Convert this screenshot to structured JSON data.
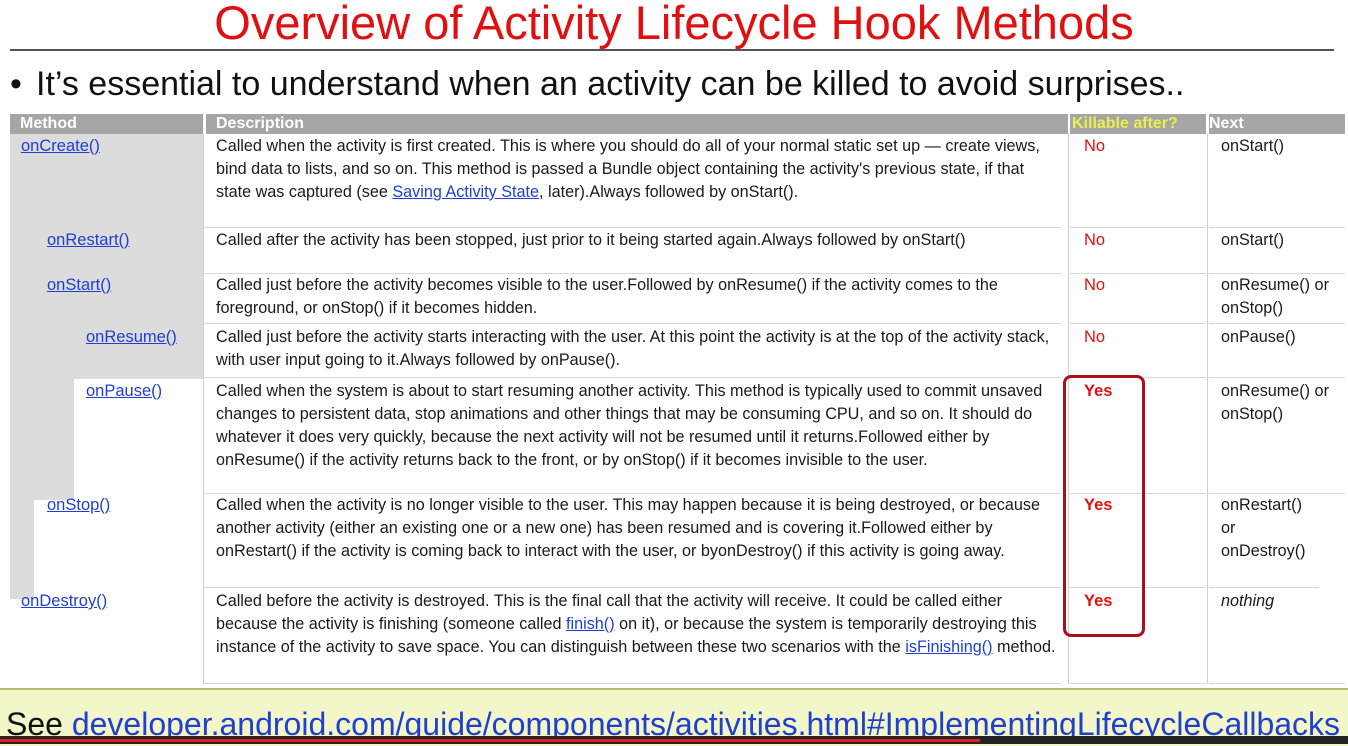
{
  "title": "Overview of Activity Lifecycle Hook Methods",
  "bullet": "It’s essential to understand when an activity can be killed to avoid surprises..",
  "headers": {
    "method": "Method",
    "description": "Description",
    "killable": "Killable after?",
    "next": "Next"
  },
  "rows": [
    {
      "method": "onCreate()",
      "desc_a": "Called when the activity is first created. This is where you should do all of your normal static set up — create views, bind data to lists, and so on. This method is passed a Bundle object containing the activity's previous state, if that state was captured (see ",
      "desc_link": "Saving Activity State",
      "desc_b": ", later).Always followed by onStart().",
      "killable": "No",
      "next": "onStart()"
    },
    {
      "method": "onRestart()",
      "desc": "Called after the activity has been stopped, just prior to it being started again.Always followed by onStart()",
      "killable": "No",
      "next": "onStart()"
    },
    {
      "method": "onStart()",
      "desc": "Called just before the activity becomes visible to the user.Followed by onResume() if the activity comes to the foreground, or onStop() if it becomes hidden.",
      "killable": "No",
      "next": "onResume() or onStop()"
    },
    {
      "method": "onResume()",
      "desc": "Called just before the activity starts interacting with the user. At this point the activity is at the top of the activity stack, with user input going to it.Always followed by onPause().",
      "killable": "No",
      "next": "onPause()"
    },
    {
      "method": "onPause()",
      "desc": "Called when the system is about to start resuming another activity. This method is typically used to commit unsaved changes to persistent data, stop animations and other things that may be consuming CPU, and so on. It should do whatever it does very quickly, because the next activity will not be resumed until it returns.Followed either by onResume() if the activity returns back to the front, or by onStop() if it becomes invisible to the user.",
      "killable": "Yes",
      "next": "onResume() or onStop()"
    },
    {
      "method": "onStop()",
      "desc": "Called when the activity is no longer visible to the user. This may happen because it is being destroyed, or because another activity (either an existing one or a new one) has been resumed and is covering it.Followed either by onRestart() if the activity is coming back to interact with the user, or byonDestroy() if this activity is going away.",
      "killable": "Yes",
      "next": "onRestart() or onDestroy()"
    },
    {
      "method": "onDestroy()",
      "desc_a": "Called before the activity is destroyed. This is the final call that the activity will receive. It could be called either because the activity is finishing (someone called ",
      "desc_link1": "finish()",
      "desc_b": " on it), or because the system is temporarily destroying this instance of the activity to save space. You can distinguish between these two scenarios with the ",
      "desc_link2": "isFinishing()",
      "desc_c": " method.",
      "killable": "Yes",
      "next": "nothing"
    }
  ],
  "footer": {
    "prefix": "See ",
    "link": "developer.android.com/guide/components/activities.html#ImplementingLifecycleCallbacks"
  },
  "colors": {
    "title": "#e01010",
    "link": "#1f3fd0",
    "header_bg": "#a6a6a6",
    "killable_header": "#e8f04a",
    "yes_box": "#a8101a",
    "footer_bg": "#f2f6c8"
  }
}
